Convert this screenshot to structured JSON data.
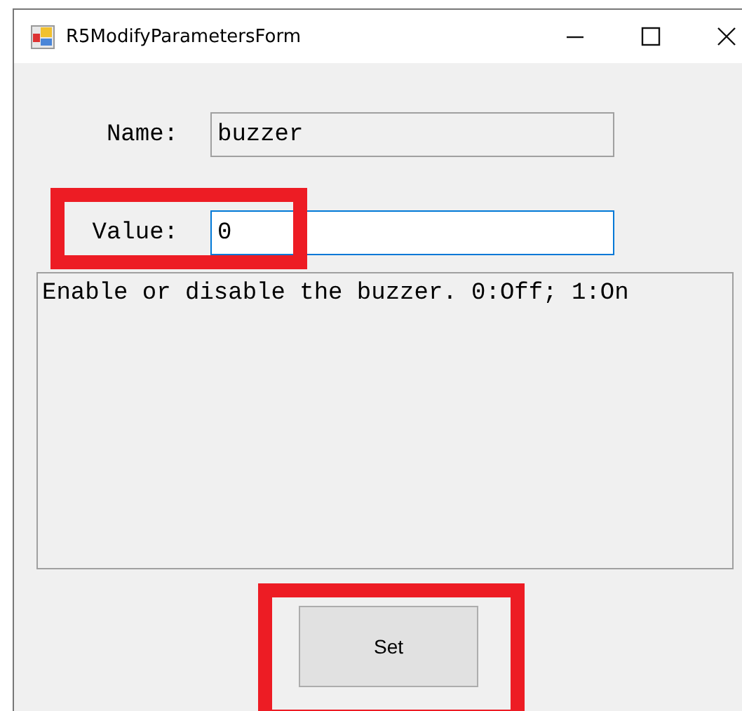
{
  "window": {
    "title": "R5ModifyParametersForm"
  },
  "fields": [
    {
      "label": "Name:",
      "value": "buzzer",
      "editable": false,
      "focused": false,
      "highlighted": false
    },
    {
      "label": "Value:",
      "value": "0",
      "editable": true,
      "focused": true,
      "highlighted": true
    }
  ],
  "description": "Enable or disable the buzzer. 0:Off; 1:On",
  "set_button": {
    "label": "Set",
    "highlighted": true
  }
}
